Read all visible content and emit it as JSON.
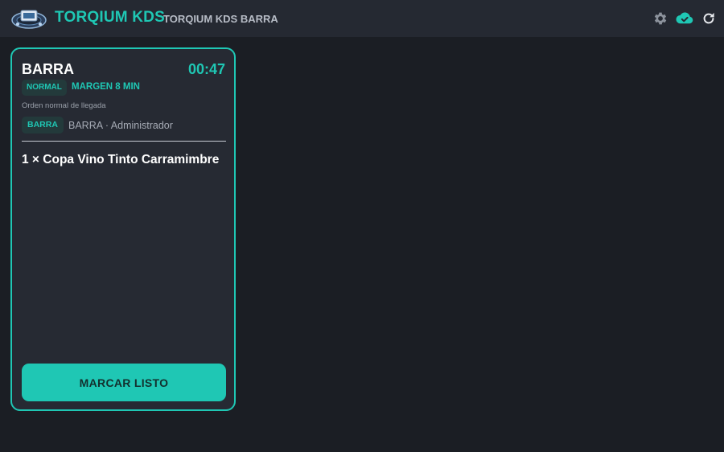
{
  "header": {
    "app_title": "TORQIUM KDS",
    "subtitle": "TORQIUM KDS BARRA",
    "icons": [
      "settings-icon",
      "cloud-check-icon",
      "refresh-icon"
    ]
  },
  "colors": {
    "accent": "#1fc7b4",
    "background": "#1b1e24",
    "topbar": "#252932",
    "card": "#262a33"
  },
  "order": {
    "station": "BARRA",
    "timer": "00:47",
    "priority_badge": "NORMAL",
    "margin": "MARGEN 8 MIN",
    "note": "Orden normal de llegada",
    "station_badge": "BARRA",
    "station_user": "BARRA · Administrador",
    "items": [
      "1 × Copa Vino Tinto Carramimbre"
    ],
    "ready_button": "MARCAR LISTO"
  }
}
